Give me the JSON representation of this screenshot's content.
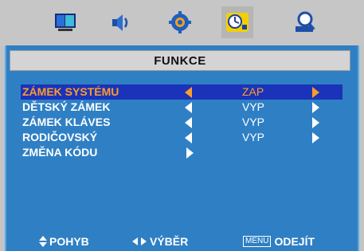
{
  "tabs": [
    {
      "icon": "monitor-icon"
    },
    {
      "icon": "speaker-icon"
    },
    {
      "icon": "gear-icon"
    },
    {
      "icon": "clock-icon",
      "active": true
    },
    {
      "icon": "magnifier-icon"
    }
  ],
  "title": "FUNKCE",
  "rows": [
    {
      "label": "ZÁMEK SYSTÉMU",
      "value": "ZAP",
      "selected": true
    },
    {
      "label": "DĚTSKÝ ZÁMEK",
      "value": "VYP"
    },
    {
      "label": "ZÁMEK KLÁVES",
      "value": "VYP"
    },
    {
      "label": "RODIČOVSKÝ",
      "value": "VYP"
    },
    {
      "label": "ZMĚNA KÓDU",
      "value": ""
    }
  ],
  "footer": {
    "move": "POHYB",
    "select": "VÝBĚR",
    "menu_key": "MENU",
    "exit": "ODEJÍT"
  },
  "colors": {
    "panel": "#2f7fc4",
    "selected_row": "#1a33b8",
    "highlight": "#ff9c2a",
    "text": "#ffffff"
  }
}
